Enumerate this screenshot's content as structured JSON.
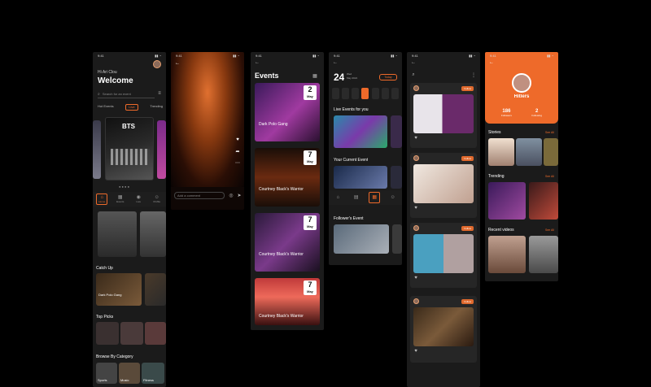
{
  "colors": {
    "accent": "#ee6a2a",
    "bg": "#000000",
    "surface": "#1b1b1b"
  },
  "status_time": "9:41",
  "home": {
    "greeting": "Hi Ari Clou",
    "title": "Welcome",
    "search_placeholder": "Search for an event",
    "tabs": [
      "Hot Events",
      "Live",
      "Trending"
    ],
    "featured_title": "BTS",
    "sections": {
      "catch_up": "Catch Up",
      "top_picks": "Top Picks",
      "browse": "Browse By Category"
    },
    "catch_items": [
      "Dark Polo Gang"
    ],
    "categories": [
      "Sports",
      "Music",
      "Fitness"
    ]
  },
  "live": {
    "comment_placeholder": "Add a comment"
  },
  "events": {
    "title": "Events",
    "cards": [
      {
        "title": "Dark Polo Gang",
        "day": "2",
        "month": "May"
      },
      {
        "title": "Courtney Black's Warrior",
        "day": "7",
        "month": "May"
      },
      {
        "title": "Courtney Black's Warrior",
        "day": "7",
        "month": "May"
      },
      {
        "title": "Courtney Black's Warrior",
        "day": "7",
        "month": "May"
      }
    ]
  },
  "calendar": {
    "day": "24",
    "weekday": "Wed",
    "month_year": "May 2021",
    "today_label": "Today",
    "sections": {
      "live": "Live Events for you",
      "current": "Your Current Event",
      "followers": "Follower's Event"
    }
  },
  "feed": {
    "follow_label": "Follow",
    "posts": [
      "post-1",
      "post-2",
      "post-3",
      "post-4"
    ]
  },
  "profile": {
    "name": "Hitlers",
    "stats": [
      {
        "value": "186",
        "label": "Followers"
      },
      {
        "value": "2",
        "label": "Following"
      }
    ],
    "sections": {
      "stories": "Stories",
      "trending": "Trending",
      "recent": "Recent videos"
    },
    "see_all": "See All"
  },
  "nav": [
    "Home",
    "Events",
    "Live",
    "Feed",
    "Profile"
  ]
}
